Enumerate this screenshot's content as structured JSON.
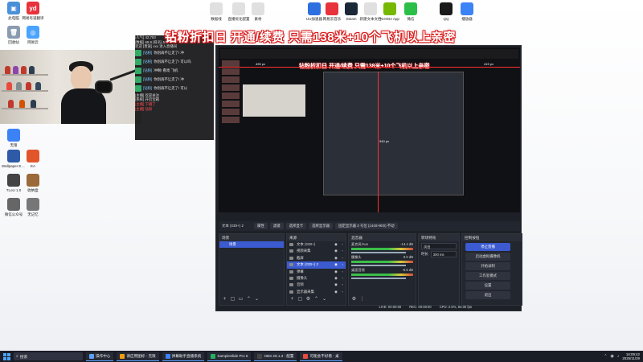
{
  "banner_text": "钻粉折扣日 开通/续费 只需138米+10个飞机以上亲密",
  "desktop_icons_top": [
    {
      "label": "此电脑",
      "color": "#4a90d9",
      "glyph": "▣"
    },
    {
      "label": "网易有道翻译",
      "color": "#e8323c",
      "glyph": "yd"
    },
    {
      "label": "回收站",
      "color": "#8a9bb0",
      "glyph": "🗑"
    },
    {
      "label": "网易云",
      "color": "#4aa3ff",
      "glyph": "◎"
    }
  ],
  "desktop_icons_row": [
    {
      "label": "数据线",
      "color": "#e0e0e0"
    },
    {
      "label": "直播优化配置",
      "color": "#e0e0e0"
    },
    {
      "label": "素材",
      "color": "#e0e0e0"
    },
    {
      "label": "UU加速器",
      "color": "#2e6fe0"
    },
    {
      "label": "网易云音乐",
      "color": "#e8323c"
    },
    {
      "label": "Steam",
      "color": "#1b2838"
    },
    {
      "label": "新建文本文档",
      "color": "#e0e0e0"
    },
    {
      "label": "NVIDIA App",
      "color": "#76b900"
    },
    {
      "label": "微信",
      "color": "#2bbf4a"
    },
    {
      "label": "QQ",
      "color": "#1a1a1a"
    },
    {
      "label": "播放器",
      "color": "#3b82f6"
    }
  ],
  "desktop_icons_left": [
    {
      "label": "无限",
      "color": "#3b82f6"
    },
    {
      "label": "Wallpaper Engine",
      "color": "#2f5aa8"
    },
    {
      "label": "EA",
      "color": "#e2552b"
    },
    {
      "label": "TLoU 1.0",
      "color": "#444"
    },
    {
      "label": "收纳盒",
      "color": "#9a6a38"
    },
    {
      "label": "微信公众号",
      "color": "#666"
    },
    {
      "label": "无记忆",
      "color": "#777"
    }
  ],
  "chat": {
    "stats": [
      "[人气] 42,783",
      "[数据] 68.8  [排名] 5%"
    ],
    "welcome": "欢迎 [贵族] xxx 进入直播间",
    "messages": [
      {
        "name": "[钻粉]",
        "text": "你别再不让走了! 冲"
      },
      {
        "name": "[钻粉]",
        "text": "你别再不让走了! 可以吗"
      },
      {
        "name": "[钻粉]",
        "text": "冲啊! 看戏 飞机"
      },
      {
        "name": "[钻粉]",
        "text": "你别再不让走了! 冲"
      },
      {
        "name": "[钻粉]",
        "text": "你别再不让走了! 可以"
      }
    ],
    "footer_lines": [
      "[主播] 欢迎关注",
      "[系统] 开启宝箱"
    ],
    "red_lines": [
      "[主播] 下播了",
      "[主播] 钻粉"
    ]
  },
  "obs": {
    "preview_labels": {
      "left": "495 px",
      "right": "415 px",
      "bottom": "940 px"
    },
    "control_bar": {
      "source_name": "文本 (GDI+) 2",
      "buttons": [
        "属性",
        "滤镜",
        "选择显卡",
        "选择显示器",
        "固定显示器 3 号位 (1440×900) 不动"
      ]
    },
    "scenes": {
      "title": "场景",
      "items": [
        "场景"
      ]
    },
    "sources": {
      "title": "来源",
      "items": [
        "文本 (GDI+)",
        "视频采集",
        "截屏",
        "文本 (GDI+) 2",
        "弹幕",
        "摄像头",
        "音频",
        "显示器采集"
      ],
      "selected_index": 3
    },
    "mixer": {
      "title": "混音器",
      "channels": [
        {
          "name": "麦克风/Aux",
          "db": "-14.4 dB"
        },
        {
          "name": "摄像头",
          "db": "0.0 dB"
        },
        {
          "name": "桌面音频",
          "db": "-6.6 dB"
        }
      ]
    },
    "transitions": {
      "title": "转场特效",
      "fields": [
        {
          "label": "",
          "value": "淡出"
        },
        {
          "label": "时长",
          "value": "300 ms"
        }
      ]
    },
    "controls": {
      "title": "控制按钮",
      "buttons": [
        "停止直播",
        "启动虚拟摄像机",
        "开始录制",
        "工作室模式",
        "设置",
        "退出"
      ]
    },
    "status": {
      "live": "LIVE: 00:00:00",
      "rec": "REC: 00:00:00",
      "cpu": "CPU: 2.5%, 60.00 fps"
    }
  },
  "taskbar": {
    "search_placeholder": "搜索",
    "apps": [
      {
        "label": "操作中心",
        "color": "#5aa0ff"
      },
      {
        "label": "请应用图标 - 无限",
        "color": "#f39c12"
      },
      {
        "label": "弹幕助手直播系统",
        "color": "#3b82f6"
      },
      {
        "label": "SampleSlide Pro 6",
        "color": "#27ae60"
      },
      {
        "label": "OBS 29.1.3 - 配置",
        "color": "#444"
      },
      {
        "label": "可能会不好看 - 桌",
        "color": "#e74c3c"
      }
    ],
    "time": "16:09:42",
    "date": "2025/11/29"
  }
}
